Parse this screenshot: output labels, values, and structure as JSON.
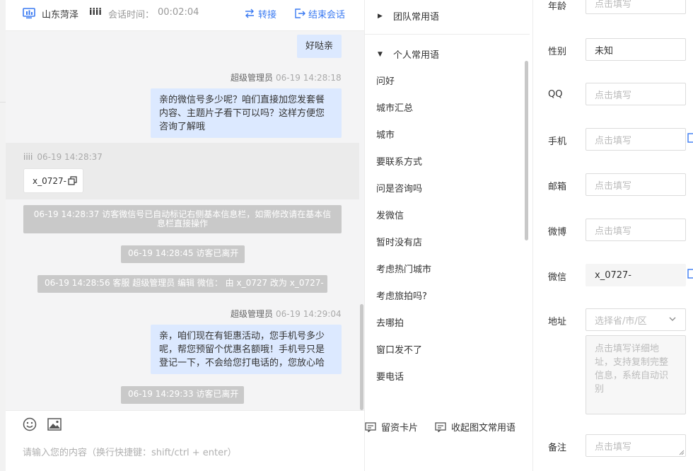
{
  "header": {
    "location": "山东菏泽",
    "visitor_name": "iiii",
    "duration_label": "会话时间：",
    "duration_value": "00:02:04",
    "transfer_label": "转接",
    "end_label": "结束会话"
  },
  "messages": {
    "m1_text": "好哒亲",
    "m2_sender": "超级管理员",
    "m2_time": "06-19 14:28:18",
    "m2_text": "亲的微信号多少呢？咱们直接加您发套餐内容、主题片子看下可以吗？这样方便您咨询了解哦",
    "m3_sender": "iiii",
    "m3_time": "06-19 14:28:37",
    "m3_text": "x_0727-",
    "sys1": "06-19 14:28:37 访客微信号已自动标记右侧基本信息栏，如需修改请在基本信息栏直接操作",
    "sys2": "06-19 14:28:45 访客已离开",
    "sys3": "06-19 14:28:56 客服 超级管理员 编辑 微信： 由 x_0727 改为 x_0727-",
    "m4_sender": "超级管理员",
    "m4_time": "06-19 14:29:04",
    "m4_text": "亲，咱们现在有钜惠活动，您手机号多少呢，帮您预留个优惠名额哦！手机号只是登记一下，不会给您打电话的，您放心哈",
    "sys4": "06-19 14:29:33 访客已离开"
  },
  "input": {
    "placeholder": "请输入您的内容（换行快捷键：shift/ctrl + enter）"
  },
  "phrases": {
    "team_group": "团队常用语",
    "personal_group": "个人常用语",
    "items": [
      "问好",
      "城市汇总",
      "城市",
      "要联系方式",
      "问是咨询吗",
      "发微信",
      "暂时没有店",
      "考虑热门城市",
      "考虑旅拍吗?",
      "去哪拍",
      "窗口发不了",
      "要电话"
    ],
    "card_label": "留资卡片",
    "collapse_label": "收起图文常用语"
  },
  "info": {
    "age_label": "年龄",
    "age_placeholder": "点击填写",
    "gender_label": "性别",
    "gender_value": "未知",
    "qq_label": "QQ",
    "qq_placeholder": "点击填写",
    "phone_label": "手机",
    "phone_placeholder": "点击填写",
    "email_label": "邮箱",
    "email_placeholder": "点击填写",
    "weibo_label": "微博",
    "weibo_placeholder": "点击填写",
    "wechat_label": "微信",
    "wechat_value": "x_0727-",
    "address_label": "地址",
    "address_placeholder": "选择省/市/区",
    "address_detail_placeholder": "点击填写详细地址，支持复制完整信息，系统自动识别",
    "note_label": "备注",
    "note_placeholder": "点击填写"
  },
  "colors": {
    "accent": "#3a7af2",
    "agent_bubble": "#dce9ff",
    "system_bubble": "#c9c9c9"
  }
}
